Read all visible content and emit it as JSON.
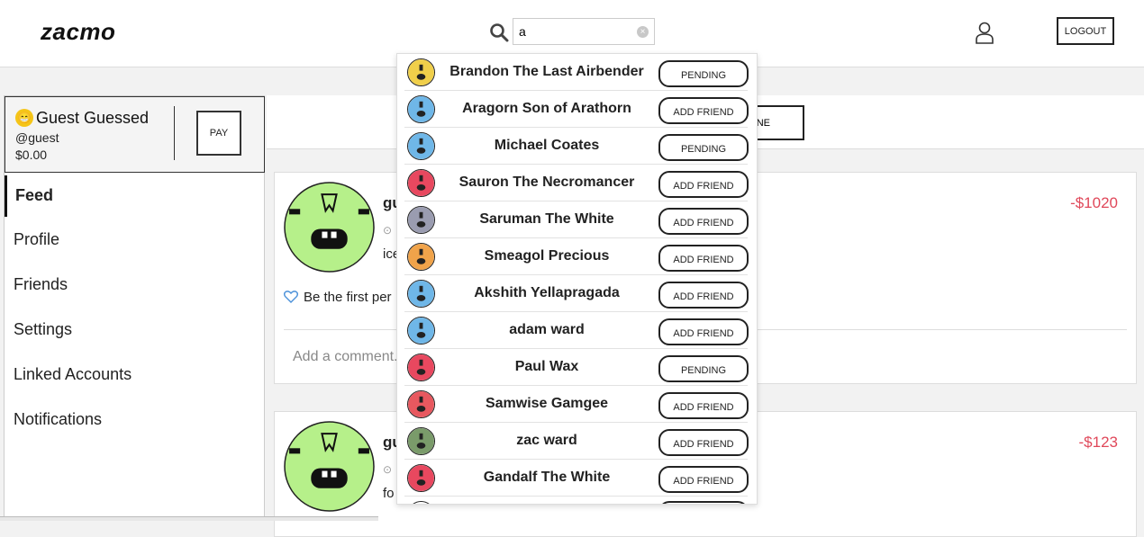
{
  "header": {
    "logo": "zacmo",
    "search_value": "a",
    "logout_label": "LOGOUT"
  },
  "sidebar": {
    "profile": {
      "name": "Guest Guessed",
      "handle": "@guest",
      "balance": "$0.00",
      "pay_label": "PAY"
    },
    "items": [
      {
        "label": "Feed",
        "active": true
      },
      {
        "label": "Profile"
      },
      {
        "label": "Friends"
      },
      {
        "label": "Settings"
      },
      {
        "label": "Linked Accounts"
      },
      {
        "label": "Notifications"
      }
    ]
  },
  "main": {
    "done_label": "NE",
    "feed": [
      {
        "name": "gu",
        "desc": "ice",
        "amount": "-$1020",
        "like_text": "Be the first per",
        "comment_placeholder": "Add a comment..."
      },
      {
        "name": "gu",
        "desc": "fo",
        "amount": "-$123"
      }
    ]
  },
  "search_results": [
    {
      "name": "Brandon The Last Airbender",
      "action": "PENDING",
      "avatar_color": "#f0cf4a"
    },
    {
      "name": "Aragorn Son of Arathorn",
      "action": "ADD FRIEND",
      "avatar_color": "#6fb7e8"
    },
    {
      "name": "Michael Coates",
      "action": "PENDING",
      "avatar_color": "#6fb7e8"
    },
    {
      "name": "Sauron The Necromancer",
      "action": "ADD FRIEND",
      "avatar_color": "#e8485f"
    },
    {
      "name": "Saruman The White",
      "action": "ADD FRIEND",
      "avatar_color": "#9a9cb0"
    },
    {
      "name": "Smeagol Precious",
      "action": "ADD FRIEND",
      "avatar_color": "#f0a34a"
    },
    {
      "name": "Akshith Yellapragada",
      "action": "ADD FRIEND",
      "avatar_color": "#6fb7e8"
    },
    {
      "name": "adam ward",
      "action": "ADD FRIEND",
      "avatar_color": "#6fb7e8"
    },
    {
      "name": "Paul Wax",
      "action": "PENDING",
      "avatar_color": "#e8485f"
    },
    {
      "name": "Samwise Gamgee",
      "action": "ADD FRIEND",
      "avatar_color": "#e8585f"
    },
    {
      "name": "zac ward",
      "action": "ADD FRIEND",
      "avatar_color": "#7a9b6a"
    },
    {
      "name": "Gandalf The White",
      "action": "ADD FRIEND",
      "avatar_color": "#e8485f"
    }
  ],
  "colors": {
    "amount_negative": "#e0485a",
    "avatar_green": "#b6f08a"
  }
}
